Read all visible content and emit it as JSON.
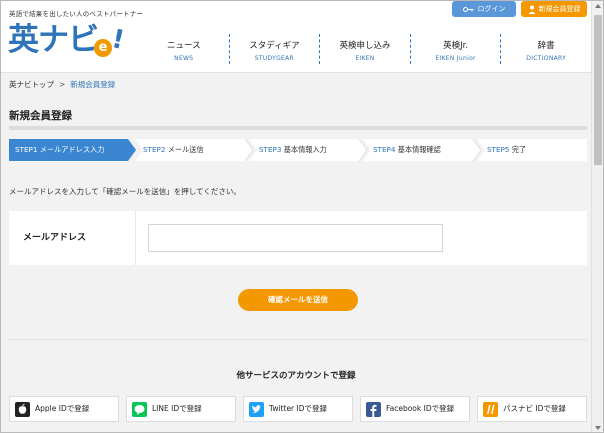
{
  "header": {
    "tagline": "英語で結果を出したい人のベストパートナー",
    "logo_text": "英ナビ",
    "logo_e": "e",
    "logo_bang": "!",
    "login_label": "ログイン",
    "register_label": "新規会員登録",
    "nav": [
      {
        "label": "ニュース",
        "sub": "NEWS"
      },
      {
        "label": "スタディギア",
        "sub": "STUDYGEAR"
      },
      {
        "label": "英検申し込み",
        "sub": "EIKEN"
      },
      {
        "label": "英検Jr.",
        "sub": "EIKEN Junior"
      },
      {
        "label": "辞書",
        "sub": "DICTIONARY"
      }
    ]
  },
  "breadcrumb": {
    "home": "英ナビトップ",
    "separator": ">",
    "current": "新規会員登録"
  },
  "page_title": "新規会員登録",
  "steps": [
    {
      "num": "STEP1",
      "name": "メールアドレス入力",
      "active": true
    },
    {
      "num": "STEP2",
      "name": "メール送信",
      "active": false
    },
    {
      "num": "STEP3",
      "name": "基本情報入力",
      "active": false
    },
    {
      "num": "STEP4",
      "name": "基本情報確認",
      "active": false
    },
    {
      "num": "STEP5",
      "name": "完了",
      "active": false
    }
  ],
  "instruction": "メールアドレスを入力して「確認メールを送信」を押してください。",
  "form": {
    "email_label": "メールアドレス",
    "email_value": "",
    "email_placeholder": ""
  },
  "submit_label": "確認メールを送信",
  "other_services_title": "他サービスのアカウントで登録",
  "socials": [
    {
      "name": "apple",
      "label": "Apple IDで登録",
      "icon": "apple-icon",
      "color": "#222222"
    },
    {
      "name": "line",
      "label": "LINE IDで登録",
      "icon": "line-icon",
      "color": "#06c755"
    },
    {
      "name": "twitter",
      "label": "Twitter IDで登録",
      "icon": "twitter-icon",
      "color": "#1da1f2"
    },
    {
      "name": "facebook",
      "label": "Facebook IDで登録",
      "icon": "facebook-icon",
      "color": "#3b5998"
    },
    {
      "name": "pasunavi",
      "label": "パスナビ IDで登録",
      "icon": "pasunavi-icon",
      "color": "#f39800"
    }
  ],
  "colors": {
    "accent": "#2f74b9",
    "orange": "#f39800",
    "login_blue": "#5a97d8"
  }
}
